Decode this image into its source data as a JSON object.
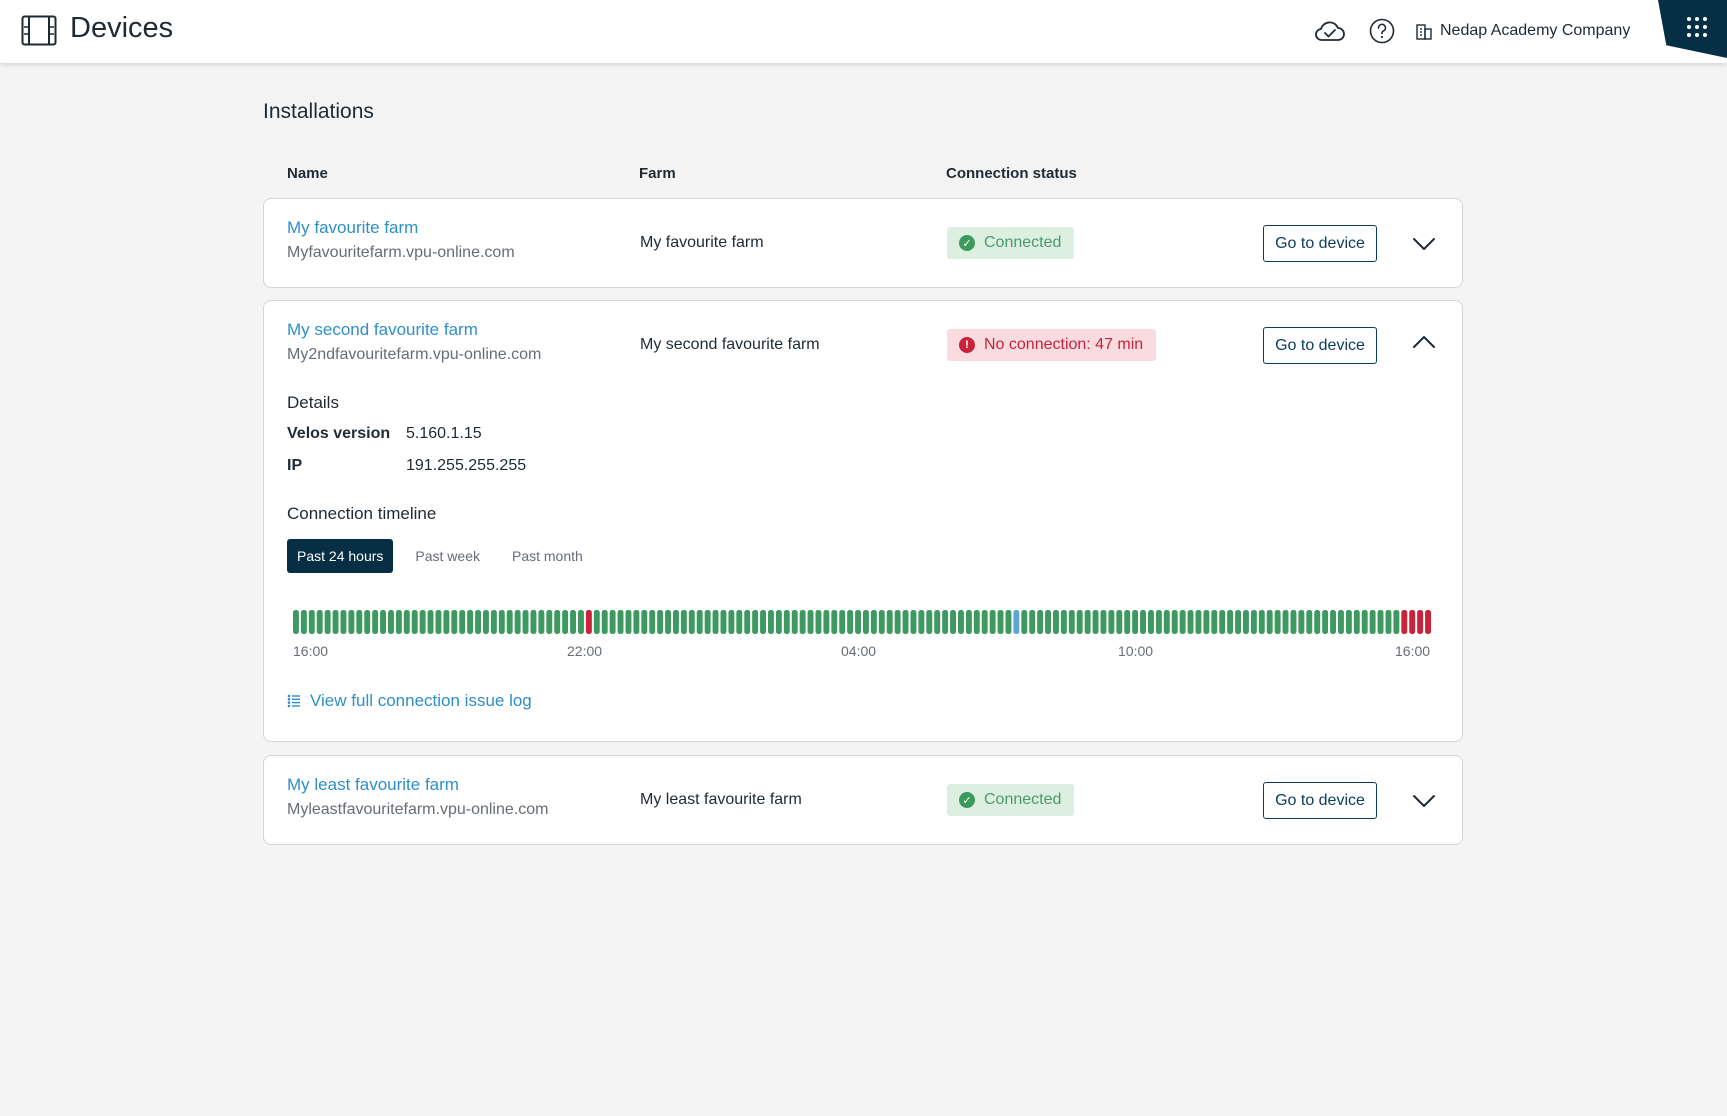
{
  "header": {
    "title": "Devices",
    "company": "Nedap Academy Company",
    "icons": [
      "devices-icon",
      "cloud-check-icon",
      "help-icon",
      "building-icon",
      "apps-grid-icon"
    ]
  },
  "section_title": "Installations",
  "columns": {
    "name": "Name",
    "farm": "Farm",
    "status": "Connection status"
  },
  "colors": {
    "link": "#2e8fc9",
    "connected": "#3c9a5f",
    "disconnected": "#c8233a",
    "unknown": "#5aa7d6",
    "primary": "#062f45"
  },
  "installations": [
    {
      "name": "My favourite farm",
      "url": "Myfavouritefarm.vpu-online.com",
      "farm": "My favourite farm",
      "status": "Connected",
      "status_type": "ok",
      "button": "Go to device",
      "expanded": false
    },
    {
      "name": "My second favourite farm",
      "url": "My2ndfavouritefarm.vpu-online.com",
      "farm": "My second favourite farm",
      "status": "No connection: 47 min",
      "status_type": "bad",
      "button": "Go to device",
      "expanded": true,
      "details": {
        "title": "Details",
        "velos_label": "Velos version",
        "velos_value": "5.160.1.15",
        "ip_label": "IP",
        "ip_value": "191.255.255.255"
      },
      "timeline": {
        "title": "Connection timeline",
        "tabs": [
          "Past 24 hours",
          "Past week",
          "Past month"
        ],
        "active_tab": "Past 24 hours",
        "tick_labels": [
          "16:00",
          "22:00",
          "04:00",
          "10:00",
          "16:00"
        ],
        "segments": "gggggggggggggggggggggggggggggggggggggrgggggggggggggggggggggggggggggggggggggggggggggggggggggbggggggggggggggggggggggggggggggggggggggggggggggggrrrr",
        "log_link": "View full connection issue log"
      }
    },
    {
      "name": "My least favourite farm",
      "url": "Myleastfavouritefarm.vpu-online.com",
      "farm": "My least favourite farm",
      "status": "Connected",
      "status_type": "ok",
      "button": "Go to device",
      "expanded": false
    }
  ]
}
